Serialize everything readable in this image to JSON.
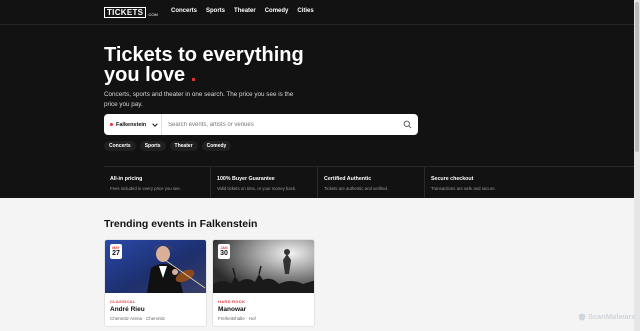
{
  "nav": {
    "logo_main": "TICKETS",
    "logo_suffix": ".COM",
    "links": [
      "Concerts",
      "Sports",
      "Theater",
      "Comedy",
      "Cities"
    ]
  },
  "hero": {
    "title_line1": "Tickets to everything",
    "title_line2": "you love",
    "title_dot": ".",
    "subtitle": "Concerts, sports and theater in one search. The price you see is the price you pay."
  },
  "search": {
    "location": "Falkenstein",
    "placeholder": "Search events, artists or venues"
  },
  "chips": [
    "Concerts",
    "Sports",
    "Theater",
    "Comedy"
  ],
  "features": [
    {
      "title": "All-in pricing",
      "desc": "Fees included in every price you see."
    },
    {
      "title": "100% Buyer Guarantee",
      "desc": "Valid tickets on time, or your money back."
    },
    {
      "title": "Certified Authentic",
      "desc": "Tickets are authentic and verified."
    },
    {
      "title": "Secure checkout",
      "desc": "Transactions are safe and secure."
    }
  ],
  "trending": {
    "title": "Trending events in Falkenstein",
    "events": [
      {
        "month": "MAY",
        "day": "27",
        "category": "CLASSICAL",
        "name": "André Rieu",
        "venue": "Chemnitz Arena · Chemnitz"
      },
      {
        "month": "JAN",
        "day": "30",
        "category": "HARD ROCK",
        "name": "Manowar",
        "venue": "Freiheitshalle · Hof"
      }
    ]
  },
  "watermark": "ScanMalware",
  "colors": {
    "accent": "#e33333",
    "dark_bg": "#121212",
    "page_bg": "#f4f4f4"
  }
}
